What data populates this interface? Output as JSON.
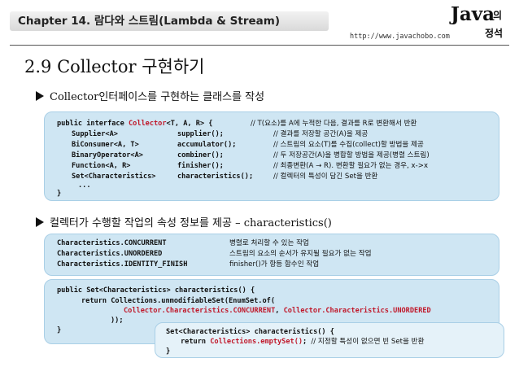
{
  "header": {
    "chapter": "Chapter 14. 람다와 스트림(Lambda & Stream)",
    "logo_java": "Java",
    "logo_ko1": "의",
    "logo_ko2": "정석",
    "url": "http://www.javachobo.com"
  },
  "title": "2.9  Collector 구현하기",
  "bullets": [
    "Collector인터페이스를 구현하는 클래스를 작성",
    "컬렉터가 수행할 작업의 속성 정보를 제공 – characteristics()"
  ],
  "interface_code": {
    "decl_pre": "public interface ",
    "decl_red": "Collector",
    "decl_post": "<T, A, R> {",
    "decl_comment": "// T(요소)를 A에 누적한 다음, 결과를 R로 변환해서 반환",
    "members": [
      {
        "type": "Supplier<A>",
        "name": "supplier();",
        "comment": "// 결과를 저장할 공간(A)을 제공"
      },
      {
        "type": "BiConsumer<A, T>",
        "name": "accumulator();",
        "comment": "// 스트림의 요소(T)를 수집(collect)할 방법을 제공"
      },
      {
        "type": "BinaryOperator<A>",
        "name": "combiner();",
        "comment": "// 두 저장공간(A)을 병합할 방법을 제공(병렬 스트림)"
      },
      {
        "type": "Function<A, R>",
        "name": "finisher();",
        "comment": "// 최종변환(A → R). 변환할 필요가 없는 경우, x->x"
      },
      {
        "type": "Set<Characteristics>",
        "name": "characteristics();",
        "comment": "// 컬렉터의 특성이 담긴 Set을 반환"
      }
    ],
    "ellipsis": "...",
    "close": "}"
  },
  "constants": [
    {
      "name": "Characteristics.CONCURRENT",
      "desc": "병렬로 처리할 수 있는 작업"
    },
    {
      "name": "Characteristics.UNORDERED",
      "desc": "스트림의 요소의 순서가 유지될 필요가 없는 작업"
    },
    {
      "name": "Characteristics.IDENTITY_FINISH",
      "desc": "finisher()가 항등 함수인 작업"
    }
  ],
  "method_code": {
    "l1": "public Set<Characteristics> characteristics() {",
    "l2": "return Collections.unmodifiableSet(EnumSet.of(",
    "l3a": "Collector.Characteristics.CONCURRENT",
    "l3sep": ", ",
    "l3b": "Collector.Characteristics.UNORDERED",
    "l4": "));",
    "l5": "}"
  },
  "empty_code": {
    "l1": "Set<Characteristics> characteristics() {",
    "l2a": "return ",
    "l2red": "Collections.emptySet()",
    "l2b": "; ",
    "l2comment": "// 지정할 특성이 없으면 빈 Set을 반환",
    "l3": "}"
  }
}
